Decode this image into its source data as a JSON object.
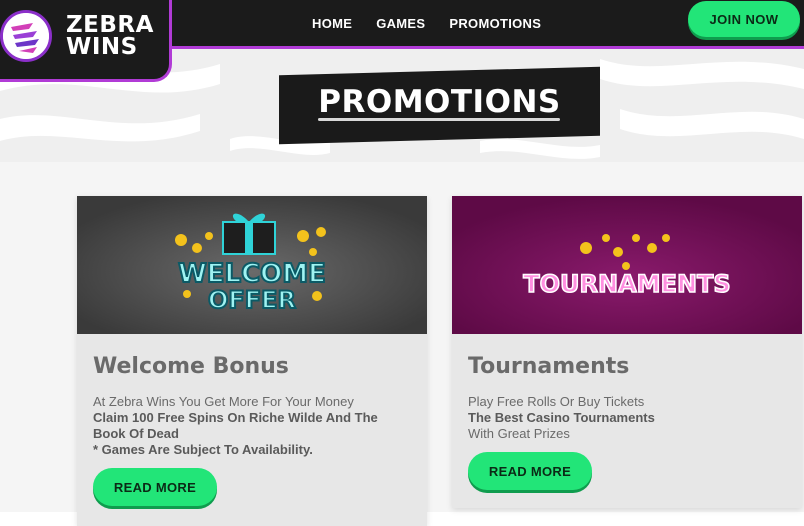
{
  "brand": {
    "line1": "ZEBRA",
    "line2": "WINS"
  },
  "nav": {
    "home": "HOME",
    "games": "GAMES",
    "promotions": "PROMOTIONS"
  },
  "header": {
    "join_label": "JOIN NOW"
  },
  "page": {
    "title": "PROMOTIONS"
  },
  "cards": [
    {
      "banner_line1": "WELCOME",
      "banner_line2": "OFFER",
      "title": "Welcome Bonus",
      "desc_plain": "At Zebra Wins You Get More For Your Money",
      "desc_strong": "Claim 100 Free Spins On Riche Wilde And The Book Of Dead",
      "desc_note": "* Games Are Subject To Availability.",
      "button": "READ MORE"
    },
    {
      "banner_line1": "TOURNAMENTS",
      "title": "Tournaments",
      "desc_plain": "Play Free Rolls Or Buy Tickets",
      "desc_strong": "The Best Casino Tournaments",
      "desc_plain2": "With Great Prizes",
      "button": "READ MORE"
    }
  ],
  "colors": {
    "accent": "#22e578",
    "brand_purple": "#b13bd6",
    "dark": "#1b1b1b",
    "tournament_bg": "#6e0b52"
  }
}
